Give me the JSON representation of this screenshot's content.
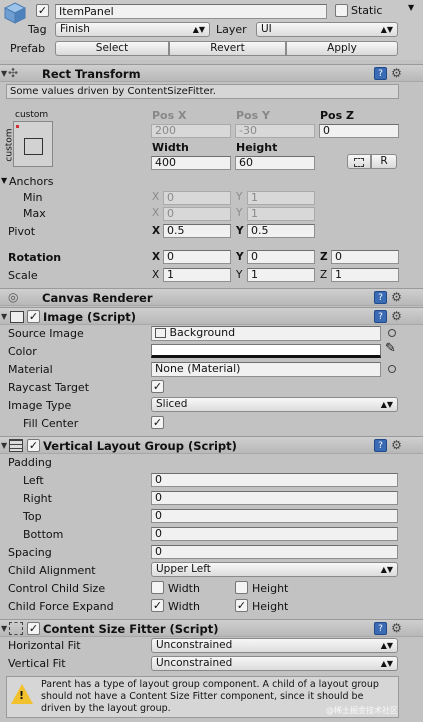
{
  "top": {
    "name": "ItemPanel",
    "static_label": "Static",
    "tag_label": "Tag",
    "tag_value": "Finish",
    "layer_label": "Layer",
    "layer_value": "UI",
    "prefab_label": "Prefab",
    "select_label": "Select",
    "revert_label": "Revert",
    "apply_label": "Apply"
  },
  "rect": {
    "title": "Rect Transform",
    "info": "Some values driven by ContentSizeFitter.",
    "anchor_preset_top": "custom",
    "anchor_preset_side": "custom",
    "posx_label": "Pos X",
    "posy_label": "Pos Y",
    "posz_label": "Pos Z",
    "posx": "200",
    "posy": "-30",
    "posz": "0",
    "width_label": "Width",
    "height_label": "Height",
    "width": "400",
    "height": "60",
    "r_button": "R",
    "anchors_label": "Anchors",
    "min_label": "Min",
    "max_label": "Max",
    "min_x": "0",
    "min_y": "1",
    "max_x": "0",
    "max_y": "1",
    "pivot_label": "Pivot",
    "pivot_x": "0.5",
    "pivot_y": "0.5",
    "rotation_label": "Rotation",
    "rot_x": "0",
    "rot_y": "0",
    "rot_z": "0",
    "scale_label": "Scale",
    "scale_x": "1",
    "scale_y": "1",
    "scale_z": "1",
    "x": "X",
    "y": "Y",
    "z": "Z"
  },
  "canvas_renderer": {
    "title": "Canvas Renderer"
  },
  "image": {
    "title": "Image (Script)",
    "source_label": "Source Image",
    "source_value": "Background",
    "color_label": "Color",
    "color_value": "#ffffff",
    "material_label": "Material",
    "material_value": "None (Material)",
    "raycast_label": "Raycast Target",
    "type_label": "Image Type",
    "type_value": "Sliced",
    "fill_center_label": "Fill Center"
  },
  "vlg": {
    "title": "Vertical Layout Group (Script)",
    "padding_label": "Padding",
    "left_label": "Left",
    "left": "0",
    "right_label": "Right",
    "right": "0",
    "top_label": "Top",
    "top": "0",
    "bottom_label": "Bottom",
    "bottom": "0",
    "spacing_label": "Spacing",
    "spacing": "0",
    "child_alignment_label": "Child Alignment",
    "child_alignment": "Upper Left",
    "control_size_label": "Control Child Size",
    "force_expand_label": "Child Force Expand",
    "width_label": "Width",
    "height_label": "Height"
  },
  "csf": {
    "title": "Content Size Fitter (Script)",
    "horizontal_label": "Horizontal Fit",
    "horizontal": "Unconstrained",
    "vertical_label": "Vertical Fit",
    "vertical": "Unconstrained",
    "warning": "Parent has a type of layout group component. A child of a layout group should not have a Content Size Fitter component, since it should be driven by the layout group."
  },
  "watermark": "@稀土掘金技术社区"
}
